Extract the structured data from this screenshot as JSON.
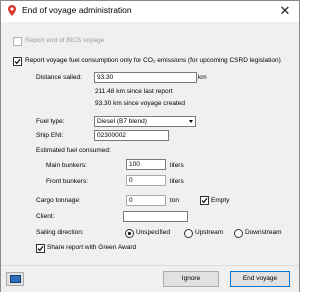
{
  "window": {
    "title": "End of voyage administration",
    "close_glyph": "✕"
  },
  "bics": {
    "label": "Report end of BICS voyage",
    "checked": false,
    "disabled": true
  },
  "report_fuel": {
    "label": "Report voyage fuel consumption only for CO₂ emissions (for upcoming CSRD legislation)",
    "checked": true
  },
  "distance": {
    "label": "Distance sailed:",
    "value": "93.30",
    "unit": "km",
    "note_since_last": "211.48 km since last report",
    "note_since_created": "93.30 km since voyage created"
  },
  "fuel_type": {
    "label": "Fuel type:",
    "selected": "Diesel (B7 blend)"
  },
  "ship_eni": {
    "label": "Ship ENI:",
    "value": "02300002"
  },
  "fuel_consumed": {
    "label": "Estimated fuel consumed:",
    "main_label": "Main bunkers:",
    "main_value": "100",
    "main_unit": "liters",
    "front_label": "Front bunkers:",
    "front_value": "0",
    "front_unit": "liters"
  },
  "cargo": {
    "label": "Cargo tonnage:",
    "value": "0",
    "unit": "ton",
    "empty_label": "Empty",
    "empty_checked": true
  },
  "client": {
    "label": "Client:",
    "value": ""
  },
  "sailing": {
    "label": "Sailing direction:",
    "options": [
      "Unspecified",
      "Upstream",
      "Downstream"
    ],
    "selected": "Unspecified"
  },
  "green_award": {
    "label": "Share report with Green Award",
    "checked": true
  },
  "footer": {
    "ignore_label": "Ignore",
    "end_label": "End voyage"
  },
  "colors": {
    "accent": "#0078d7",
    "app_icon": "#d9342b"
  },
  "icons": {
    "app": "location-pin-icon",
    "screen": "monitor-icon",
    "check": "checkmark-icon"
  }
}
